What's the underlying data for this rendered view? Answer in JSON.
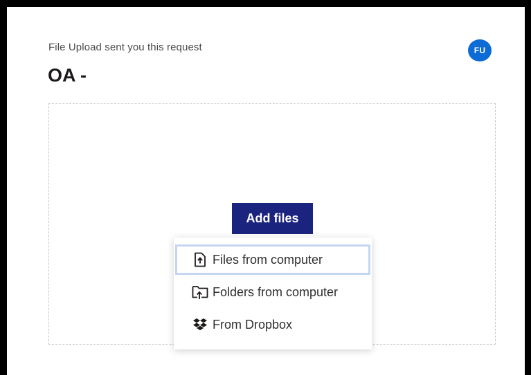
{
  "request": {
    "sender_text": "File Upload sent you this request",
    "title": "OA -",
    "avatar_initials": "FU"
  },
  "upload": {
    "add_files_label": "Add files",
    "menu": [
      {
        "label": "Files from computer",
        "icon": "file-upload-icon",
        "focused": true
      },
      {
        "label": "Folders from computer",
        "icon": "folder-upload-icon",
        "focused": false
      },
      {
        "label": "From Dropbox",
        "icon": "dropbox-icon",
        "focused": false
      }
    ]
  },
  "colors": {
    "button_bg": "#1a237e",
    "avatar_bg": "#0d6bd6",
    "focus_ring": "#c5d6f2"
  }
}
